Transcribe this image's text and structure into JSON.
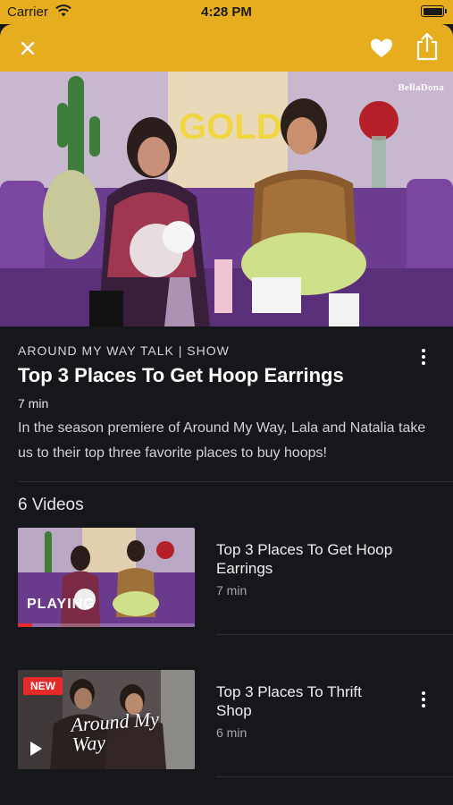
{
  "status_bar": {
    "carrier": "Carrier",
    "time": "4:28 PM"
  },
  "top_bar": {
    "close_icon": "close-icon",
    "favorite_icon": "heart-icon",
    "share_icon": "share-icon",
    "background": "#e6ad1f"
  },
  "hero": {
    "brand": "BellaDona"
  },
  "episode": {
    "category": "AROUND MY WAY  TALK | SHOW",
    "title": "Top 3 Places To Get Hoop Earrings",
    "duration": "7 min",
    "description": "In the season premiere of Around My Way, Lala and Natalia take us to their top three favorite places to buy hoops!"
  },
  "videos_section": {
    "heading": "6 Videos"
  },
  "videos": [
    {
      "title": "Top 3 Places To Get Hoop Earrings",
      "duration": "7 min",
      "status": "PLAYING",
      "progress": 0.08
    },
    {
      "title": "Top 3 Places To Thrift Shop",
      "duration": "6 min",
      "badge": "NEW",
      "overlay": "Around My Way"
    }
  ],
  "colors": {
    "accent": "#e6ad1f",
    "badge": "#e52a2a",
    "background": "#15171b"
  }
}
